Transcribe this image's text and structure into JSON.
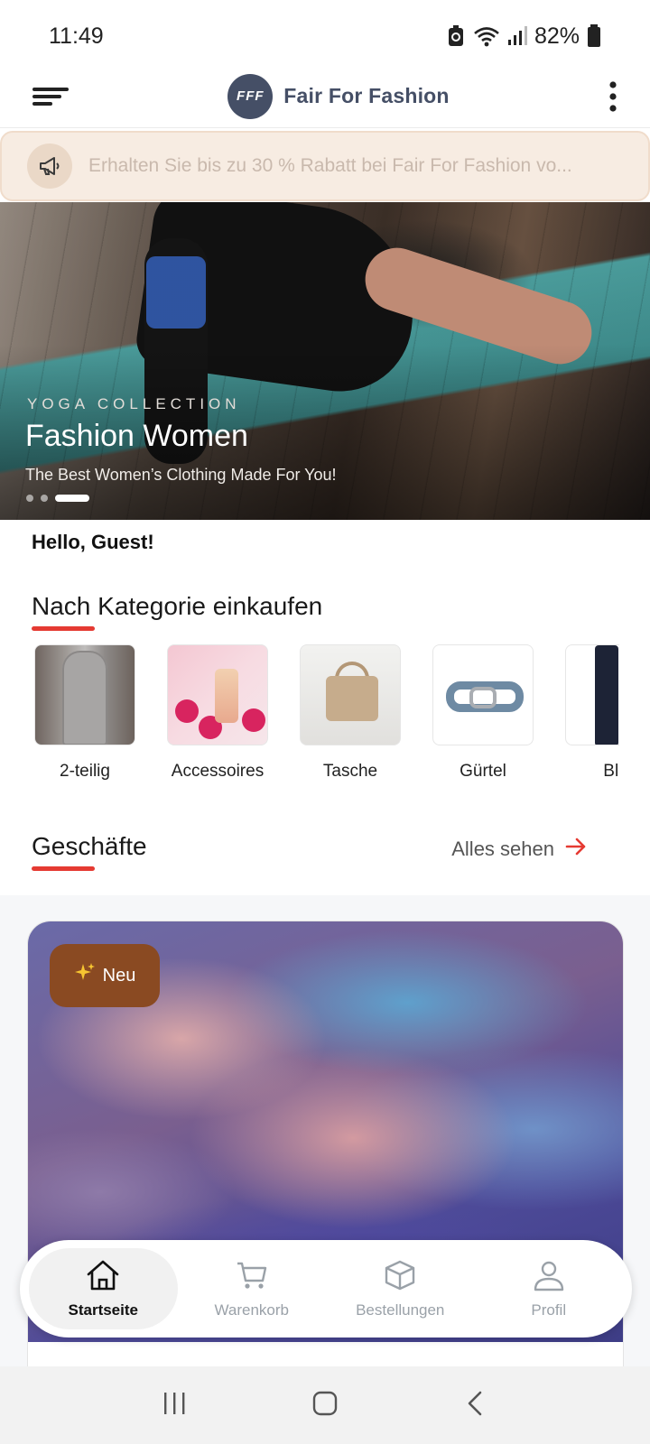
{
  "status_bar": {
    "time": "11:49",
    "battery": "82%",
    "icons": [
      "battery-saver-icon",
      "wifi-icon",
      "signal-icon",
      "battery-icon"
    ]
  },
  "app_bar": {
    "logo_text": "FFF",
    "brand_name": "Fair For Fashion",
    "brand_color": "#454f66",
    "menu_icon": "menu-icon",
    "more_icon": "more-vertical-icon"
  },
  "promo": {
    "text": "Erhalten Sie bis zu 30 % Rabatt bei Fair For Fashion vo...",
    "icon": "megaphone-icon"
  },
  "hero": {
    "eyebrow": "YOGA COLLECTION",
    "title": "Fashion Women",
    "subtitle": "The Best Women’s Clothing Made For You!",
    "slides_total": 3,
    "active_slide": 3
  },
  "greeting": "Hello, Guest!",
  "categories_section": {
    "title": "Nach Kategorie einkaufen",
    "items": [
      {
        "label": "2-teilig"
      },
      {
        "label": "Accessoires"
      },
      {
        "label": "Tasche"
      },
      {
        "label": "Gürtel"
      },
      {
        "label": "Bla"
      }
    ]
  },
  "shops_section": {
    "title": "Geschäfte",
    "see_all": "Alles sehen",
    "card": {
      "badge": "Neu",
      "badge_color": "#8a4a22"
    }
  },
  "bottom_nav": {
    "items": [
      {
        "label": "Startseite",
        "icon": "home-icon",
        "active": true
      },
      {
        "label": "Warenkorb",
        "icon": "cart-icon",
        "active": false
      },
      {
        "label": "Bestellungen",
        "icon": "box-icon",
        "active": false
      },
      {
        "label": "Profil",
        "icon": "user-icon",
        "active": false
      }
    ]
  },
  "accent_color": "#e53a32"
}
